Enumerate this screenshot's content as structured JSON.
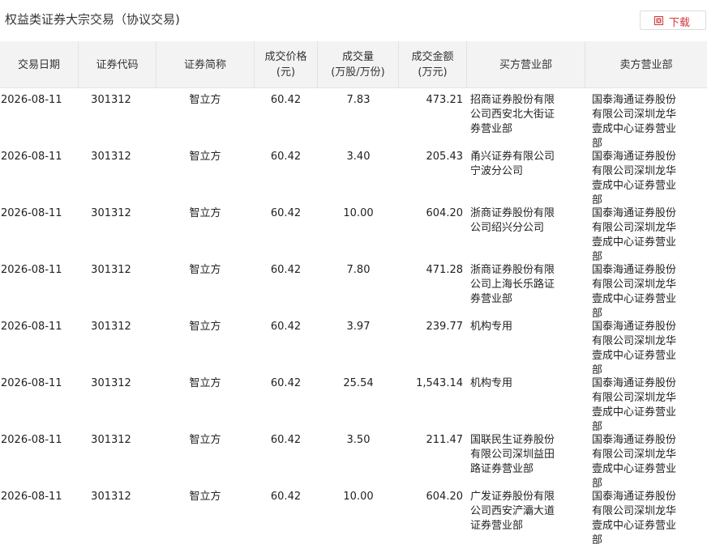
{
  "page": {
    "title": "权益类证券大宗交易（协议交易)",
    "download_label": "下载",
    "accent_color": "#d0383a"
  },
  "table": {
    "headers": {
      "date": [
        "交易日期"
      ],
      "code": [
        "证券代码"
      ],
      "name": [
        "证券简称"
      ],
      "price": [
        "成交价格",
        "(元)"
      ],
      "volume": [
        "成交量",
        "(万股/万份)"
      ],
      "amount": [
        "成交金额",
        "(万元)"
      ],
      "buyer": [
        "买方营业部"
      ],
      "seller": [
        "卖方营业部"
      ]
    },
    "rows": [
      {
        "date": "2026-08-11",
        "code": "301312",
        "name": "智立方",
        "price": "60.42",
        "volume": "7.83",
        "amount": "473.21",
        "buyer": "招商证券股份有限公司西安北大街证券营业部",
        "seller": "国泰海通证券股份有限公司深圳龙华壹成中心证券营业部"
      },
      {
        "date": "2026-08-11",
        "code": "301312",
        "name": "智立方",
        "price": "60.42",
        "volume": "3.40",
        "amount": "205.43",
        "buyer": "甬兴证券有限公司宁波分公司",
        "seller": "国泰海通证券股份有限公司深圳龙华壹成中心证券营业部"
      },
      {
        "date": "2026-08-11",
        "code": "301312",
        "name": "智立方",
        "price": "60.42",
        "volume": "10.00",
        "amount": "604.20",
        "buyer": "浙商证券股份有限公司绍兴分公司",
        "seller": "国泰海通证券股份有限公司深圳龙华壹成中心证券营业部"
      },
      {
        "date": "2026-08-11",
        "code": "301312",
        "name": "智立方",
        "price": "60.42",
        "volume": "7.80",
        "amount": "471.28",
        "buyer": "浙商证券股份有限公司上海长乐路证券营业部",
        "seller": "国泰海通证券股份有限公司深圳龙华壹成中心证券营业部"
      },
      {
        "date": "2026-08-11",
        "code": "301312",
        "name": "智立方",
        "price": "60.42",
        "volume": "3.97",
        "amount": "239.77",
        "buyer": "机构专用",
        "seller": "国泰海通证券股份有限公司深圳龙华壹成中心证券营业部"
      },
      {
        "date": "2026-08-11",
        "code": "301312",
        "name": "智立方",
        "price": "60.42",
        "volume": "25.54",
        "amount": "1,543.14",
        "buyer": "机构专用",
        "seller": "国泰海通证券股份有限公司深圳龙华壹成中心证券营业部"
      },
      {
        "date": "2026-08-11",
        "code": "301312",
        "name": "智立方",
        "price": "60.42",
        "volume": "3.50",
        "amount": "211.47",
        "buyer": "国联民生证券股份有限公司深圳益田路证券营业部",
        "seller": "国泰海通证券股份有限公司深圳龙华壹成中心证券营业部"
      },
      {
        "date": "2026-08-11",
        "code": "301312",
        "name": "智立方",
        "price": "60.42",
        "volume": "10.00",
        "amount": "604.20",
        "buyer": "广发证券股份有限公司西安浐灞大道证券营业部",
        "seller": "国泰海通证券股份有限公司深圳龙华壹成中心证券营业部"
      }
    ]
  }
}
